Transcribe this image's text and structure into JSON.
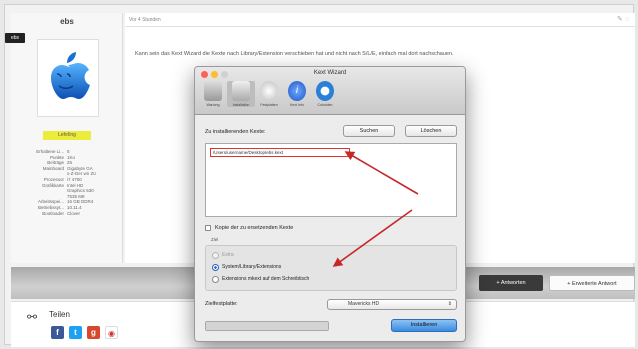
{
  "profile": {
    "username": "ebs",
    "role_badge": "ebs",
    "rank": "Lehrling",
    "stats": [
      {
        "k": "Erhaltene Li...",
        "v": "5"
      },
      {
        "k": "Punkte",
        "v": "1Ko"
      },
      {
        "k": "Beiträge",
        "v": "25"
      },
      {
        "k": "Mainboard",
        "v": "Gigabyte GA"
      },
      {
        "k": "",
        "v": "x-Z-Der wn Zü"
      },
      {
        "k": "Prozessor",
        "v": "i7 4700"
      },
      {
        "k": "Grafikkarte",
        "v": "Intel HD"
      },
      {
        "k": "",
        "v": "Graphics 530"
      },
      {
        "k": "",
        "v": "7535 M8"
      },
      {
        "k": "Arbeitsspei...",
        "v": "16 GB DDR4"
      },
      {
        "k": "Betriebssyt...",
        "v": "10.11.4"
      },
      {
        "k": "Bootloader",
        "v": "Clover"
      }
    ]
  },
  "post": {
    "header": "Vor 4 Stunden",
    "body": "Kann sein das Kext Wizard die Kexte nach Library/Extension verschieben hat und nicht nach S/L/E, einfach mal dort nachschauen."
  },
  "actions": {
    "reply": "Antworten",
    "advanced_reply": "Erweiterte Antwort"
  },
  "share": {
    "label": "Teilen"
  },
  "kext_wizard": {
    "title": "Kext Wizard",
    "toolbar": [
      "Wartung",
      "Installation",
      "Festplatten",
      "Kext Info",
      "Cuboiden"
    ],
    "kexts_label": "Zu installierenden Kexte:",
    "search_button": "Suchen",
    "delete_button": "Löschen",
    "kext_path": "/Users/username/Desktop/ebs.kext",
    "copy_checkbox": "Kopie der zu ersetzenden Kexte",
    "target_label": "Ziel",
    "targets": [
      "Extra",
      "System/Library/Extensions",
      "Extensions mkext auf dem Schreibtisch"
    ],
    "selected_target": 1,
    "disk_label": "Zielfestplatte:",
    "disk_value": "Mavericks HD",
    "install_button": "Installieren",
    "progress": 0
  },
  "colors": {
    "accent": "#3b8ce0",
    "arrow": "#c62828",
    "rank_badge": "#ecec3a"
  }
}
